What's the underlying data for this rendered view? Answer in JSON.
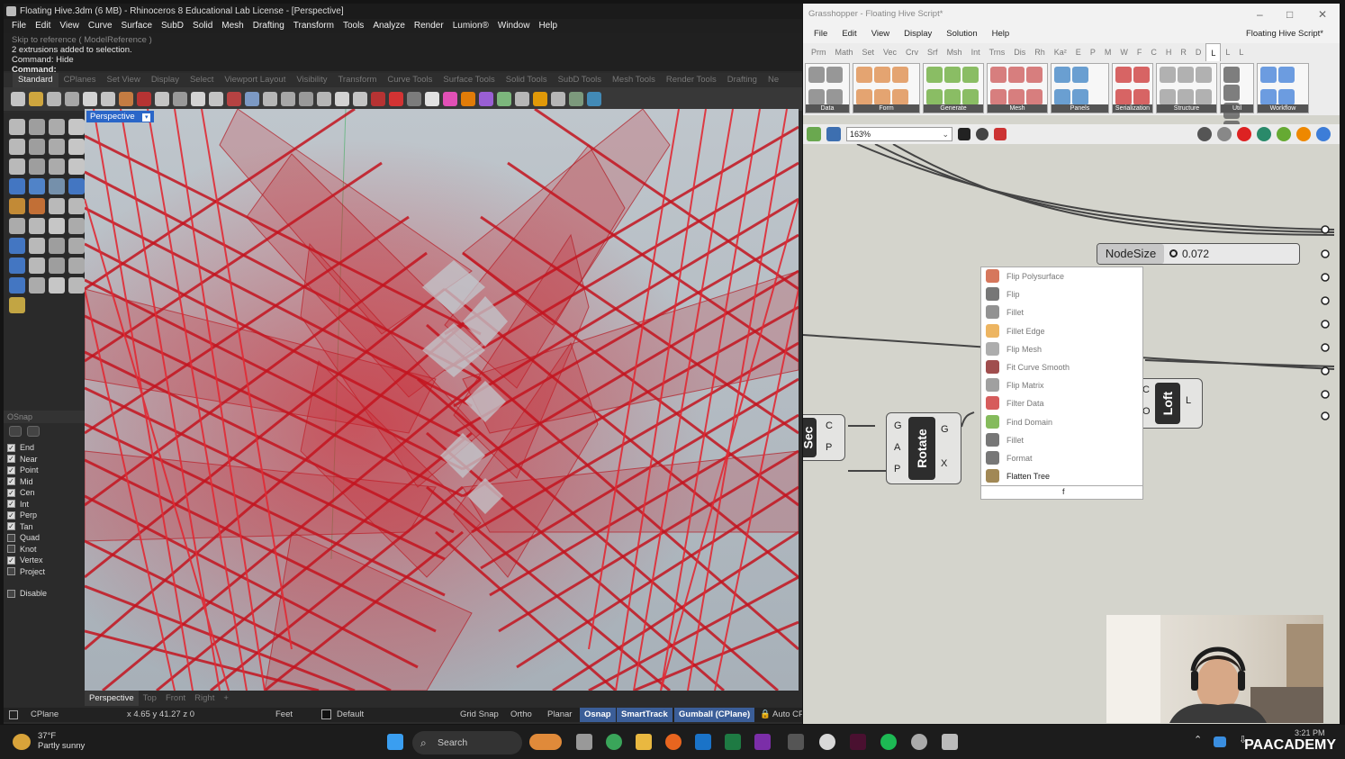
{
  "rhino": {
    "title": "Floating Hive.3dm (6 MB) - Rhinoceros 8 Educational Lab License - [Perspective]",
    "menu": [
      "File",
      "Edit",
      "View",
      "Curve",
      "Surface",
      "SubD",
      "Solid",
      "Mesh",
      "Drafting",
      "Transform",
      "Tools",
      "Analyze",
      "Render",
      "Lumion®",
      "Window",
      "Help"
    ],
    "command_history": [
      "Skip to reference ( ModelReference )",
      "2 extrusions added to selection.",
      "Command: Hide"
    ],
    "command_prompt": "Command:",
    "toolbar_tabs": [
      "Standard",
      "CPlanes",
      "Set View",
      "Display",
      "Select",
      "Viewport Layout",
      "Visibility",
      "Transform",
      "Curve Tools",
      "Surface Tools",
      "Solid Tools",
      "SubD Tools",
      "Mesh Tools",
      "Render Tools",
      "Drafting",
      "Ne"
    ],
    "viewport_label": "Perspective",
    "viewport_tabs": [
      "Perspective",
      "Top",
      "Front",
      "Right",
      "+"
    ],
    "osnap": {
      "title": "OSnap",
      "items": [
        {
          "label": "End",
          "checked": true
        },
        {
          "label": "Near",
          "checked": true
        },
        {
          "label": "Point",
          "checked": true
        },
        {
          "label": "Mid",
          "checked": true
        },
        {
          "label": "Cen",
          "checked": true
        },
        {
          "label": "Int",
          "checked": true
        },
        {
          "label": "Perp",
          "checked": true
        },
        {
          "label": "Tan",
          "checked": true
        },
        {
          "label": "Quad",
          "checked": false
        },
        {
          "label": "Knot",
          "checked": false
        },
        {
          "label": "Vertex",
          "checked": true
        },
        {
          "label": "Project",
          "checked": false
        }
      ],
      "disable": "Disable"
    },
    "status": {
      "cplane": "CPlane",
      "coords": "x 4.65  y 41.27  z 0",
      "units": "Feet",
      "layer": "Default",
      "grid_snap": "Grid Snap",
      "ortho": "Ortho",
      "planar": "Planar",
      "osnap": "Osnap",
      "smarttrack": "SmartTrack",
      "gumball": "Gumball (CPlane)",
      "auto_cp": "Auto CP"
    },
    "accent_color": "#c8202a"
  },
  "grasshopper": {
    "title": "Grasshopper - Floating Hive Script*",
    "menu": [
      "File",
      "Edit",
      "View",
      "Display",
      "Solution",
      "Help"
    ],
    "doc_name": "Floating Hive Script*",
    "categories": [
      "Prm",
      "Math",
      "Set",
      "Vec",
      "Crv",
      "Srf",
      "Msh",
      "Int",
      "Trns",
      "Dis",
      "Rh",
      "Ka²",
      "E",
      "P",
      "M",
      "W",
      "F",
      "C",
      "H",
      "R",
      "D",
      "L",
      "L",
      "L"
    ],
    "panels": [
      "Data",
      "Form",
      "Generate",
      "Mesh",
      "Panels",
      "Serialization",
      "Structure",
      "Util",
      "Workflow"
    ],
    "zoom": "163%",
    "slider": {
      "name": "NodeSize",
      "value": "0.072"
    },
    "popup_items": [
      "Flip Polysurface",
      "Flip",
      "Fillet",
      "Fillet Edge",
      "Flip Mesh",
      "Fit Curve Smooth",
      "Flip Matrix",
      "Filter Data",
      "Find Domain",
      "Fillet",
      "Format",
      "Flatten Tree"
    ],
    "popup_input": "f",
    "components": {
      "sec": {
        "name": "Sec",
        "inputs": [
          "C",
          "P"
        ]
      },
      "rotate": {
        "name": "Rotate",
        "inputs": [
          "G",
          "A",
          "P"
        ],
        "outputs": [
          "G",
          "X"
        ]
      },
      "loft": {
        "name": "Loft",
        "inputs": [
          "C",
          "O"
        ],
        "outputs": [
          "L"
        ]
      }
    }
  },
  "taskbar": {
    "temp": "37°F",
    "weather": "Partly sunny",
    "search": "Search",
    "clock": "3:21 PM",
    "brand": "PAACADEMY"
  }
}
